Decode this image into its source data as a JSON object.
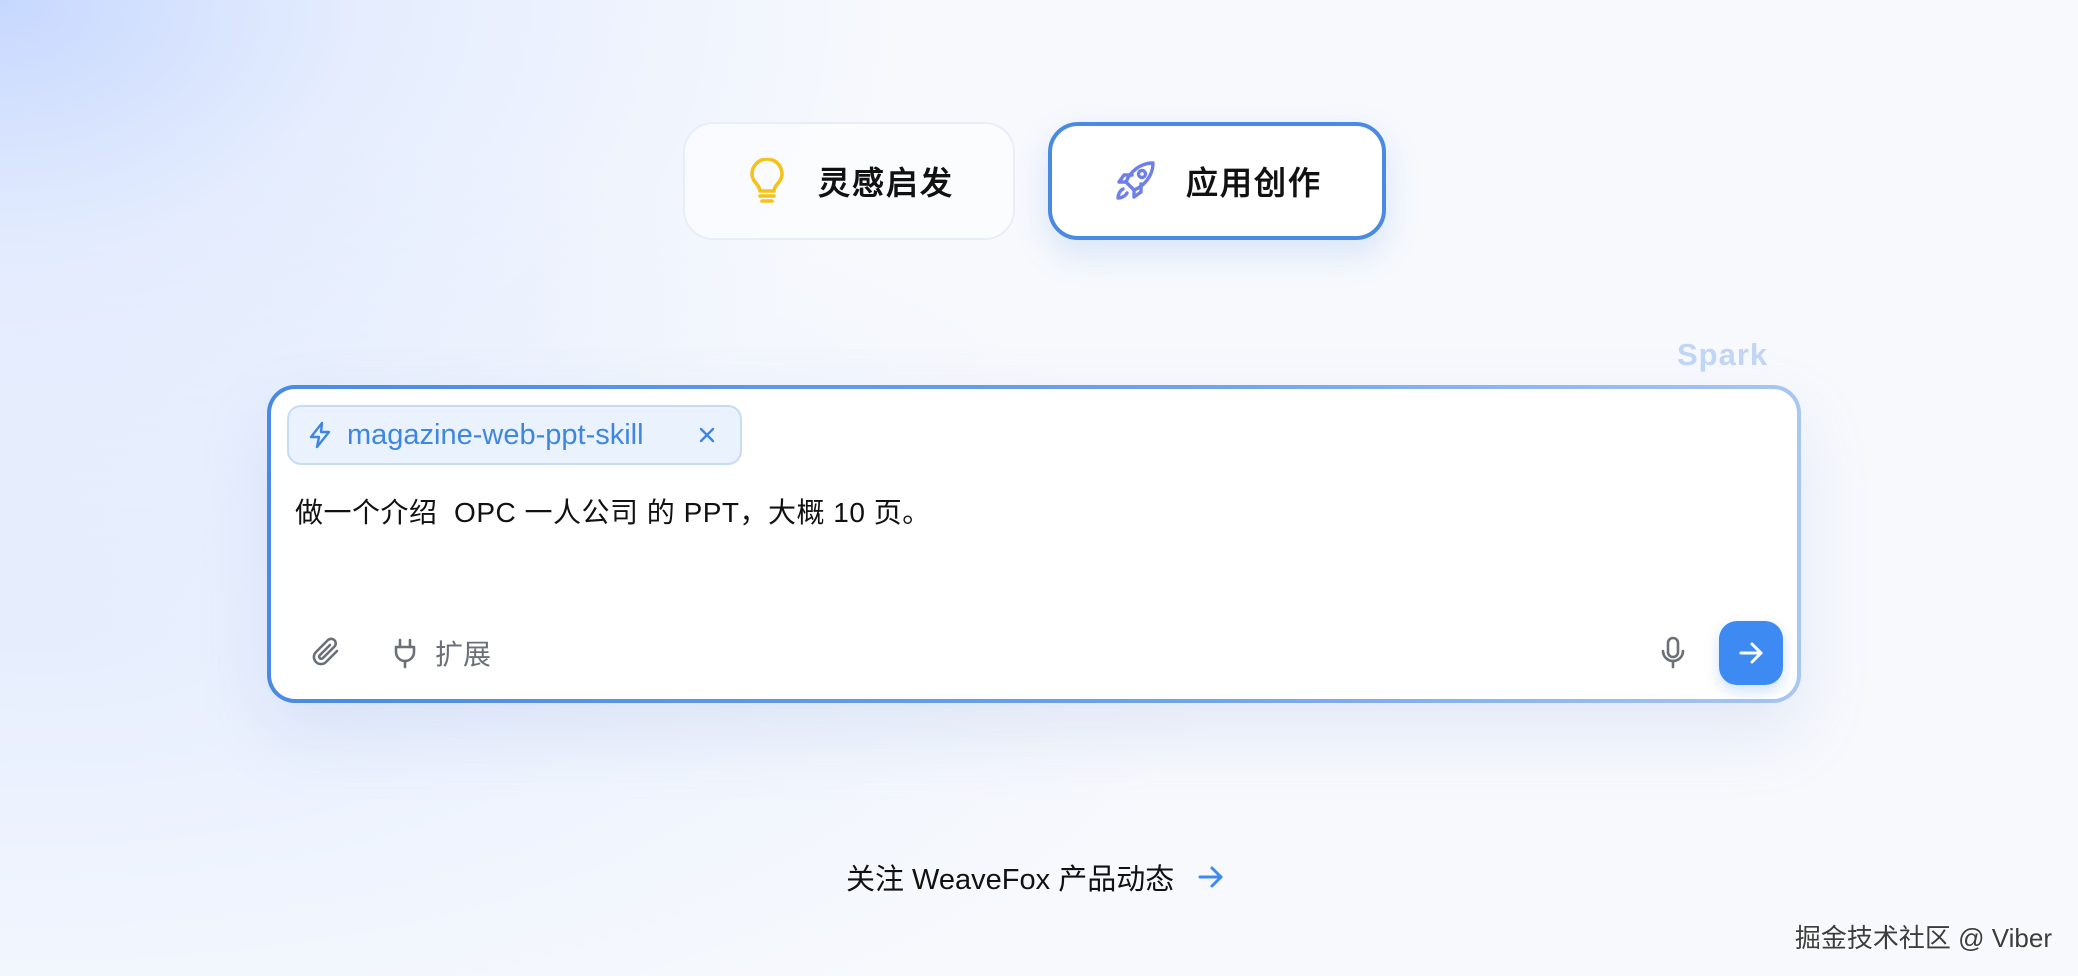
{
  "tabs": [
    {
      "label": "灵感启发",
      "icon": "lightbulb-icon",
      "active": false,
      "icon_color": "#f4c21a"
    },
    {
      "label": "应用创作",
      "icon": "rocket-icon",
      "active": true,
      "icon_color": "#6e7fe8"
    }
  ],
  "spark_label": "Spark",
  "input": {
    "skill_chip": {
      "label": "magazine-web-ppt-skill",
      "icon": "bolt-icon"
    },
    "prompt": "做一个介绍  OPC 一人公司 的 PPT，大概 10 页。",
    "extension_label": "扩展",
    "attach_icon": "paperclip-icon",
    "mic_icon": "microphone-icon",
    "send_icon": "arrow-right-icon"
  },
  "footer": {
    "follow_label": "关注 WeaveFox 产品动态"
  },
  "watermark": "掘金技术社区 @ Viber",
  "colors": {
    "accent": "#3d8bf2",
    "chip_bg": "#eaf2fd",
    "chip_text": "#3f86e0",
    "active_border": "#4a8ae3"
  }
}
